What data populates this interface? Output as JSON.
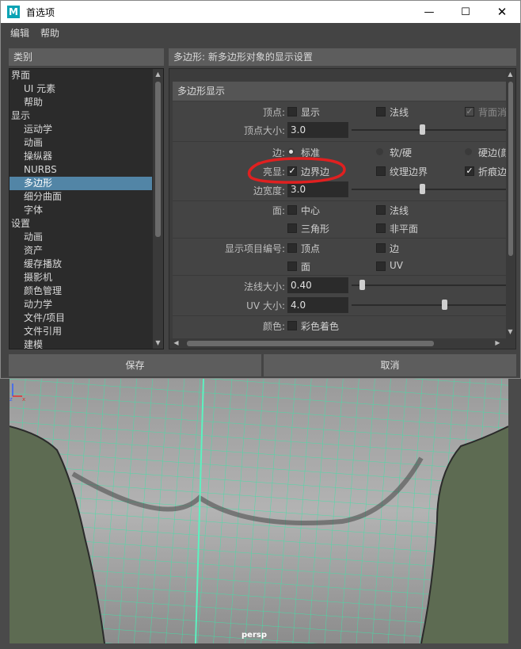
{
  "window": {
    "app_icon": "M",
    "title": "首选项",
    "controls": [
      "minimize-icon",
      "maximize-icon",
      "close-icon"
    ]
  },
  "menu": [
    "编辑",
    "帮助"
  ],
  "categories": {
    "header": "类别",
    "items": [
      {
        "label": "界面",
        "level": 0
      },
      {
        "label": "UI 元素",
        "level": 1
      },
      {
        "label": "帮助",
        "level": 1
      },
      {
        "label": "显示",
        "level": 0
      },
      {
        "label": "运动学",
        "level": 1
      },
      {
        "label": "动画",
        "level": 1
      },
      {
        "label": "操纵器",
        "level": 1
      },
      {
        "label": "NURBS",
        "level": 1
      },
      {
        "label": "多边形",
        "level": 1,
        "selected": true
      },
      {
        "label": "细分曲面",
        "level": 1
      },
      {
        "label": "字体",
        "level": 1
      },
      {
        "label": "设置",
        "level": 0
      },
      {
        "label": "动画",
        "level": 1
      },
      {
        "label": "资产",
        "level": 1
      },
      {
        "label": "缓存播放",
        "level": 1
      },
      {
        "label": "摄影机",
        "level": 1
      },
      {
        "label": "颜色管理",
        "level": 1
      },
      {
        "label": "动力学",
        "level": 1
      },
      {
        "label": "文件/项目",
        "level": 1
      },
      {
        "label": "文件引用",
        "level": 1
      },
      {
        "label": "建模",
        "level": 1
      }
    ]
  },
  "panel": {
    "header": "多边形: 新多边形对象的显示设置",
    "section": "多边形显示",
    "vertex_label": "顶点:",
    "vertex_display": "显示",
    "vertex_normals": "法线",
    "vertex_backface": "背面消",
    "vertex_size_label": "顶点大小:",
    "vertex_size": "3.0",
    "vertex_size_slider": 0.45,
    "edge_label": "边:",
    "edge_standard": "标准",
    "edge_softhard": "软/硬",
    "edge_hard": "硬边(颜",
    "highlight_label": "亮显:",
    "highlight_border": "边界边",
    "highlight_texture": "纹理边界",
    "highlight_crease": "折痕边",
    "edge_width_label": "边宽度:",
    "edge_width": "3.0",
    "edge_width_slider": 0.45,
    "face_label": "面:",
    "face_center": "中心",
    "face_normals": "法线",
    "face_triangles": "三角形",
    "face_nonplanar": "非平面",
    "numbering_label": "显示项目编号:",
    "num_vertices": "顶点",
    "num_edges": "边",
    "num_faces": "面",
    "num_uv": "UV",
    "normal_size_label": "法线大小:",
    "normal_size": "0.40",
    "normal_size_slider": 0.05,
    "uv_size_label": "UV 大小:",
    "uv_size": "4.0",
    "uv_size_slider": 0.6,
    "color_label": "颜色:",
    "color_shading": "彩色着色"
  },
  "buttons": {
    "save": "保存",
    "cancel": "取消"
  },
  "viewport": {
    "camera": "persp"
  },
  "colors": {
    "selection": "#5285a6",
    "wireframe": "#40e8b0",
    "annotation": "#e02020",
    "viewport_bg": "#5d6b52"
  }
}
